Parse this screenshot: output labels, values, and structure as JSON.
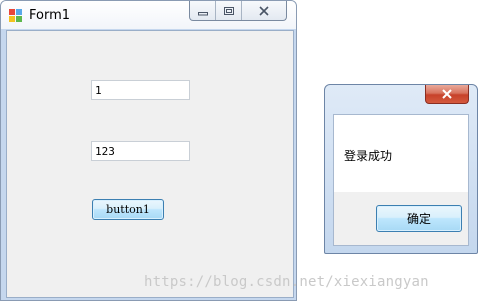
{
  "form1": {
    "title": "Form1",
    "textbox1_value": "1",
    "textbox2_value": "123",
    "button1_label": "button1"
  },
  "message_box": {
    "message": "登录成功",
    "ok_label": "确定"
  },
  "watermark": "https://blog.csdn.net/xiexiangyan",
  "icons": {
    "app": "winforms-app-icon",
    "minimize": "minimize-icon",
    "maximize": "maximize-icon",
    "close": "close-icon"
  }
}
